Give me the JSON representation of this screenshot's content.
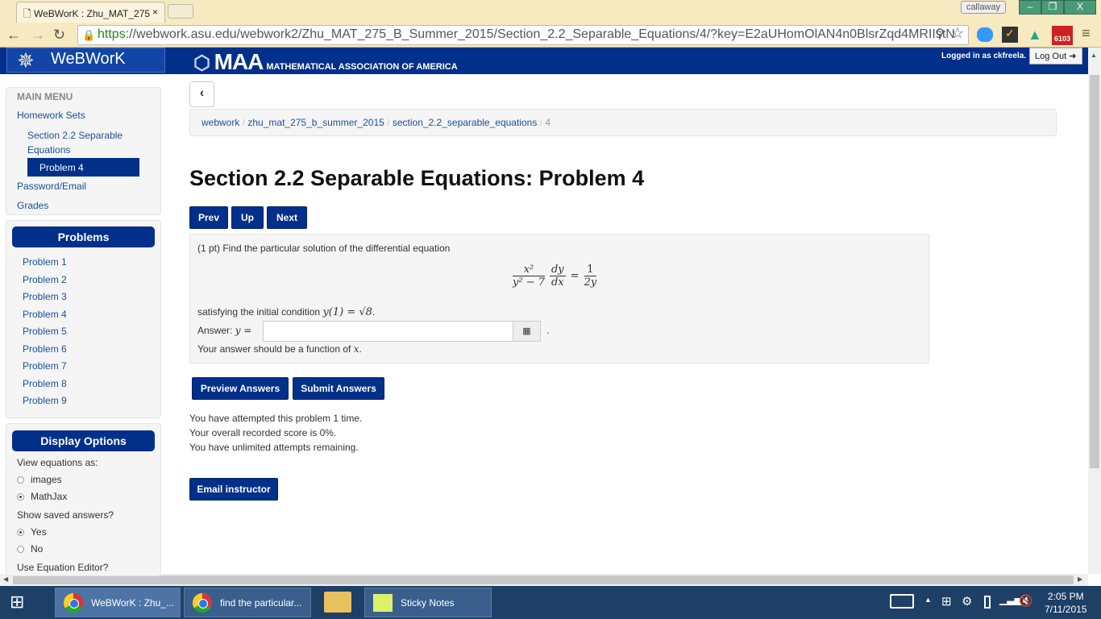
{
  "browser": {
    "tab_title": "WeBWorK : Zhu_MAT_275",
    "url_scheme": "https",
    "url_rest": "://webwork.asu.edu/webwork2/Zhu_MAT_275_B_Summer_2015/Section_2.2_Separable_Equations/4/?key=E2aUHomOlAN4n0BlsrZqd4MRIIstN",
    "profile": "callaway",
    "gmail_badge": "6103"
  },
  "header": {
    "logo": "WeBWorK",
    "maa": "MAA",
    "maa_full": "MATHEMATICAL ASSOCIATION OF AMERICA",
    "logged_in": "Logged in as ckfreela.",
    "logout": "Log Out"
  },
  "menu": {
    "title": "MAIN MENU",
    "homework_sets": "Homework Sets",
    "section": "Section 2.2 Separable Equations",
    "problem": "Problem 4",
    "password": "Password/Email",
    "grades": "Grades"
  },
  "problems": {
    "title": "Problems",
    "items": [
      "Problem 1",
      "Problem 2",
      "Problem 3",
      "Problem 4",
      "Problem 5",
      "Problem 6",
      "Problem 7",
      "Problem 8",
      "Problem 9"
    ]
  },
  "display": {
    "title": "Display Options",
    "view_label": "View equations as:",
    "opt_images": "images",
    "opt_mathjax": "MathJax",
    "saved_label": "Show saved answers?",
    "opt_yes": "Yes",
    "opt_no": "No",
    "editor_label": "Use Equation Editor?",
    "selected_view": "MathJax",
    "selected_saved": "Yes"
  },
  "breadcrumb": [
    "webwork",
    "zhu_mat_275_b_summer_2015",
    "section_2.2_separable_equations",
    "4"
  ],
  "page_title": "Section 2.2 Separable Equations: Problem 4",
  "nav": {
    "prev": "Prev",
    "up": "Up",
    "next": "Next"
  },
  "problem": {
    "intro": "(1 pt) Find the particular solution of the differential equation",
    "num1": "x²",
    "den1": "y² − 7",
    "num2": "dy",
    "den2": "dx",
    "eq": "=",
    "num3": "1",
    "den3": "2y",
    "cond_text": "satisfying the initial condition",
    "cond_math": "y(1) = √8",
    "answer_label": "Answer:",
    "answer_var": "y =",
    "answer_value": "",
    "hint": "Your answer should be a function of",
    "hint_var": "x"
  },
  "actions": {
    "preview": "Preview Answers",
    "submit": "Submit Answers",
    "email": "Email instructor"
  },
  "status": [
    "You have attempted this problem 1 time.",
    "Your overall recorded score is 0%.",
    "You have unlimited attempts remaining."
  ],
  "taskbar": {
    "items": [
      "WeBWorK : Zhu_...",
      "find the particular...",
      "Sticky Notes"
    ],
    "time": "2:05 PM",
    "date": "7/11/2015"
  }
}
